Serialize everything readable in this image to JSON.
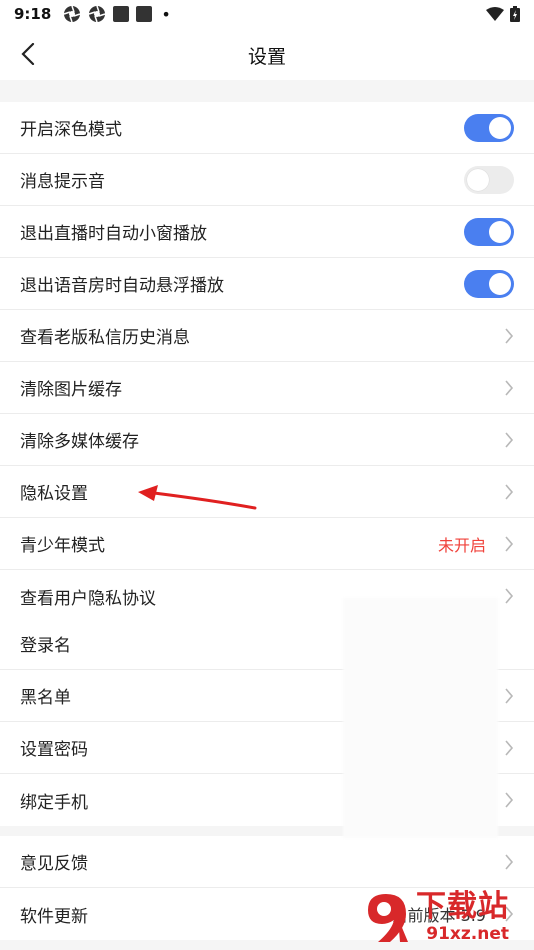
{
  "status": {
    "time": "9:18",
    "dot": "•"
  },
  "nav": {
    "title": "设置"
  },
  "group1": [
    {
      "label": "开启深色模式",
      "type": "toggle",
      "on": true
    },
    {
      "label": "消息提示音",
      "type": "toggle",
      "on": false
    },
    {
      "label": "退出直播时自动小窗播放",
      "type": "toggle",
      "on": true
    },
    {
      "label": "退出语音房时自动悬浮播放",
      "type": "toggle",
      "on": true
    },
    {
      "label": "查看老版私信历史消息",
      "type": "link"
    },
    {
      "label": "清除图片缓存",
      "type": "link"
    },
    {
      "label": "清除多媒体缓存",
      "type": "link"
    },
    {
      "label": "隐私设置",
      "type": "link"
    },
    {
      "label": "青少年模式",
      "type": "link",
      "value": "未开启"
    },
    {
      "label": "查看用户隐私协议",
      "type": "link"
    }
  ],
  "group2": [
    {
      "label": "登录名",
      "type": "plain"
    },
    {
      "label": "黑名单",
      "type": "link"
    },
    {
      "label": "设置密码",
      "type": "link"
    },
    {
      "label": "绑定手机",
      "type": "link"
    }
  ],
  "group3": [
    {
      "label": "意见反馈",
      "type": "link"
    },
    {
      "label": "软件更新",
      "type": "link",
      "value": "当前版本 3.9"
    }
  ],
  "watermark": {
    "title": "下载站",
    "url": "91xz.net"
  },
  "colors": {
    "toggle_on": "#4a7ff0",
    "accent_red": "#f0423b",
    "arrow_red": "#e02020"
  }
}
